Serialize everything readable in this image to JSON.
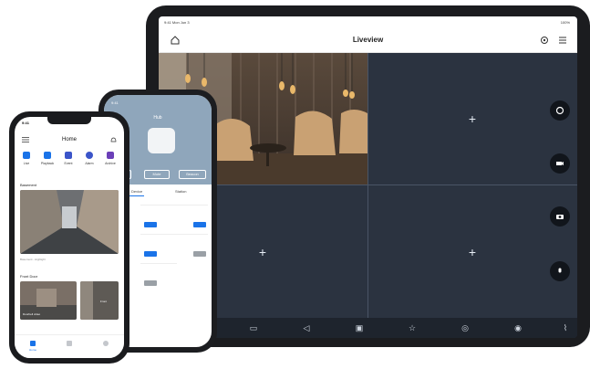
{
  "tablet": {
    "status_left": "9:41  Mon Jun 3",
    "status_right": "100%",
    "title": "Liveview",
    "cells": [
      "+",
      "+",
      "+"
    ],
    "toolbar_icons": [
      "screen-icon",
      "speaker-icon",
      "split-icon",
      "star-icon",
      "record-icon",
      "snapshot-icon",
      "more-icon"
    ],
    "side_buttons": [
      "ptz-icon",
      "video-icon",
      "camera-icon",
      "mic-icon"
    ]
  },
  "phone_middle": {
    "status": "9:41",
    "title": "Hub",
    "pills": [
      "",
      "Mute",
      "Beacon"
    ],
    "tabs": [
      "Device",
      "Station"
    ]
  },
  "phone_front": {
    "status": "9:41",
    "title": "Home",
    "nav": [
      "Live",
      "Playback",
      "Event",
      "Alarm",
      "Archive"
    ],
    "section1": "Basement",
    "section2": "Front Door",
    "caption1": "Basement  -  Highlight",
    "cam_label_a": "Doorbell video",
    "cam_label_b": "Front",
    "bottom_nav": [
      "Home",
      "",
      ""
    ]
  }
}
